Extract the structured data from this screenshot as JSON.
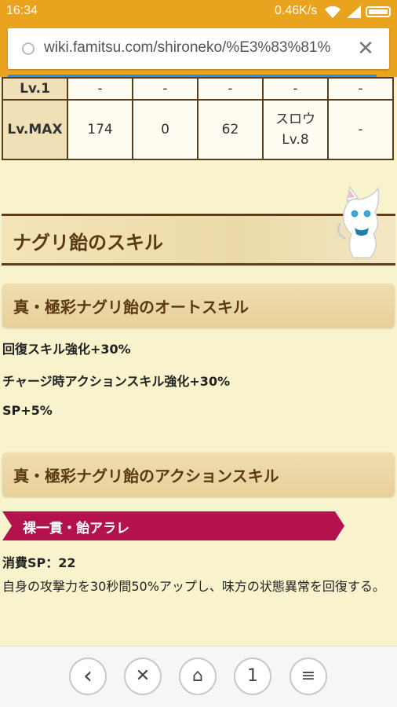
{
  "status_bar": {
    "time": "16:34",
    "network_speed": "0.46K/s",
    "icons": [
      "wifi-icon",
      "signal-icon",
      "battery-icon"
    ]
  },
  "browser": {
    "url": "wiki.famitsu.com/shironeko/%E3%83%81%",
    "close_symbol": "✕"
  },
  "stats_table": {
    "rows": [
      [
        "Lv.1",
        "-",
        "-",
        "-",
        "-",
        "-"
      ],
      [
        "Lv.MAX",
        "174",
        "0",
        "62",
        "スロウ\nLv.8",
        "-"
      ]
    ]
  },
  "section": {
    "title": "ナグリ飴のスキル"
  },
  "auto_skill": {
    "heading": "真・極彩ナグリ飴のオートスキル",
    "items": [
      "回復スキル強化+30%",
      "チャージ時アクションスキル強化+30%",
      "SP+5%"
    ]
  },
  "action_skill": {
    "heading": "真・極彩ナグリ飴のアクションスキル",
    "skill_name": "裸一貫・飴アラレ",
    "sp_cost": "消費SP：22",
    "description": "自身の攻撃力を30秒間50%アップし、味方の状態異常を回復する。"
  },
  "bottom_nav": {
    "back": "‹",
    "close": "✕",
    "home": "⌂",
    "tabs": "1",
    "menu": "≡"
  },
  "colors": {
    "accent": "#e9a31e",
    "ribbon": "#b4124e",
    "page_bg": "#f8f3cc",
    "border": "#5b3d1a"
  }
}
